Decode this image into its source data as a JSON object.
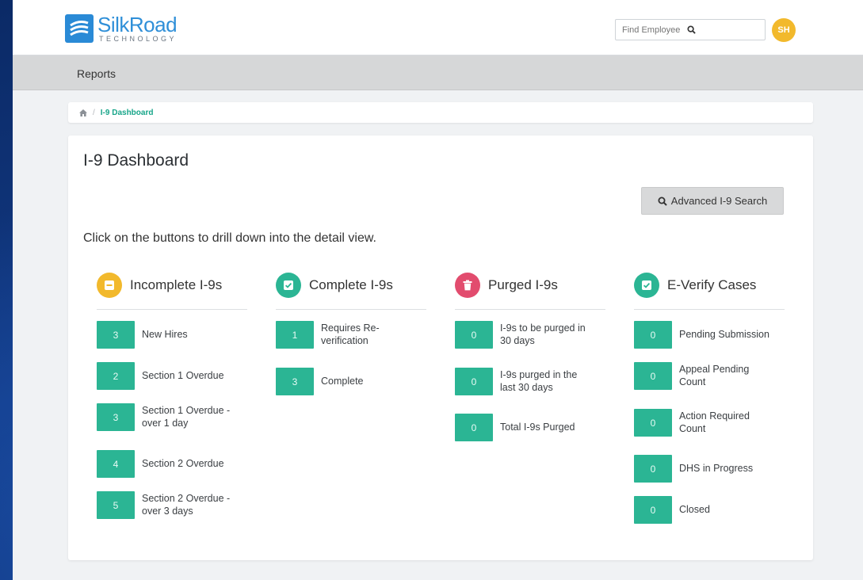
{
  "app": {
    "logo": {
      "name_part1": "Silk",
      "name_part2": "Road",
      "subtitle": "TECHNOLOGY"
    },
    "search": {
      "placeholder": "Find Employee"
    },
    "avatar": {
      "initials": "SH",
      "color": "#f2b92c"
    }
  },
  "nav": {
    "items": [
      {
        "label": "Reports"
      }
    ]
  },
  "breadcrumb": {
    "home_icon": "home-icon",
    "separator": "/",
    "current": "I-9 Dashboard"
  },
  "page": {
    "title": "I-9 Dashboard",
    "advanced_search_label": "Advanced I-9 Search",
    "instructions": "Click on the buttons to drill down into the detail view."
  },
  "colors": {
    "accent": "#2bb594",
    "incomplete": "#f2b92c",
    "complete": "#2bb594",
    "purged": "#e24c6e",
    "everify": "#2bb594"
  },
  "columns": [
    {
      "title": "Incomplete I-9s",
      "icon": "minus-square-icon",
      "rows": [
        {
          "count": "3",
          "label": "New Hires"
        },
        {
          "count": "2",
          "label": "Section 1 Overdue"
        },
        {
          "count": "3",
          "label": "Section 1 Overdue - over 1 day"
        },
        {
          "count": "4",
          "label": "Section 2 Overdue"
        },
        {
          "count": "5",
          "label": "Section 2 Overdue - over 3 days"
        }
      ]
    },
    {
      "title": "Complete I-9s",
      "icon": "check-square-icon",
      "rows": [
        {
          "count": "1",
          "label": "Requires Re-verification"
        },
        {
          "count": "3",
          "label": "Complete"
        }
      ]
    },
    {
      "title": "Purged I-9s",
      "icon": "trash-icon",
      "rows": [
        {
          "count": "0",
          "label": "I-9s to be purged in 30 days"
        },
        {
          "count": "0",
          "label": "I-9s purged in the last 30 days"
        },
        {
          "count": "0",
          "label": "Total I-9s Purged"
        }
      ]
    },
    {
      "title": "E-Verify Cases",
      "icon": "check-square-icon",
      "rows": [
        {
          "count": "0",
          "label": "Pending Submission"
        },
        {
          "count": "0",
          "label": "Appeal Pending Count"
        },
        {
          "count": "0",
          "label": "Action Required Count"
        },
        {
          "count": "0",
          "label": "DHS in Progress"
        },
        {
          "count": "0",
          "label": "Closed"
        }
      ]
    }
  ]
}
